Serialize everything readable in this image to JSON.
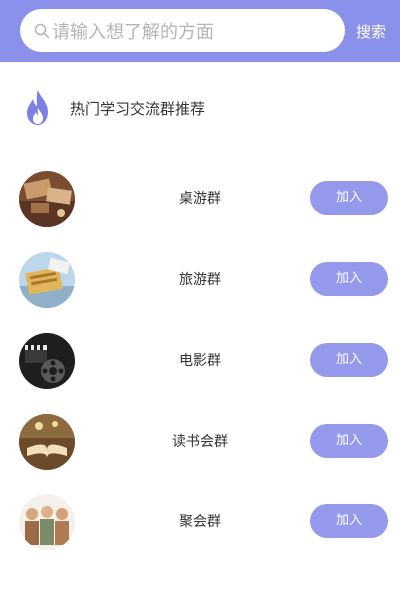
{
  "search": {
    "placeholder": "请输入想了解的方面",
    "button_label": "搜索"
  },
  "hot_section": {
    "title": "热门学习交流群推荐"
  },
  "groups": [
    {
      "name": "桌游群",
      "join_label": "加入"
    },
    {
      "name": "旅游群",
      "join_label": "加入"
    },
    {
      "name": "电影群",
      "join_label": "加入"
    },
    {
      "name": "读书会群",
      "join_label": "加入"
    },
    {
      "name": "聚会群",
      "join_label": "加入"
    }
  ],
  "colors": {
    "accent": "#8b90ea",
    "button": "#9499ec",
    "fire": "#7b7fe6"
  },
  "icons": {
    "search": "search-icon",
    "hot": "fire-icon"
  }
}
